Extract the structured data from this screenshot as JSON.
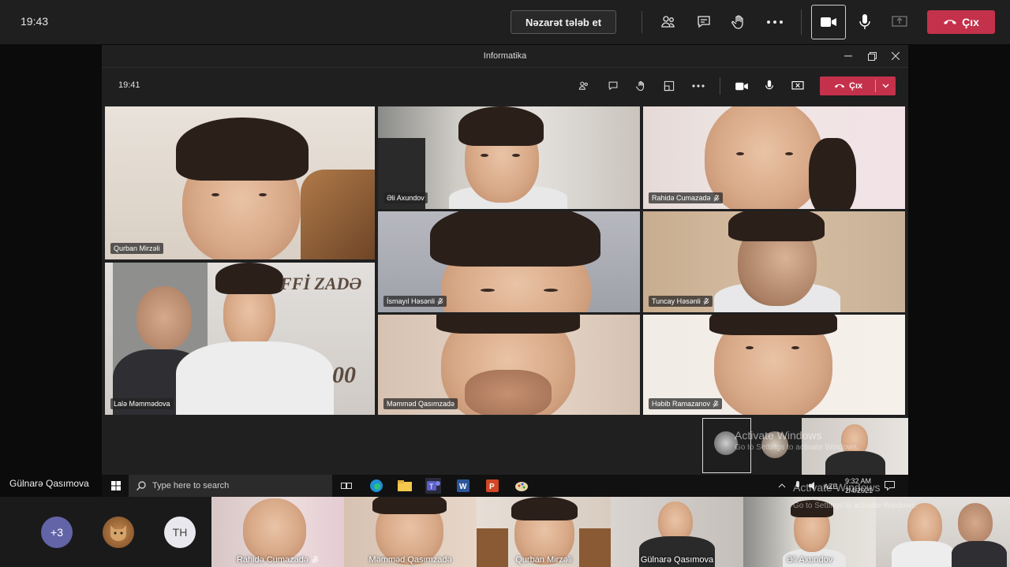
{
  "outer": {
    "time": "19:43",
    "request_control_label": "Nəzarət tələb et",
    "leave_label": "Çıx",
    "icons": [
      "people-icon",
      "chat-icon",
      "raise-hand-icon",
      "more-icon",
      "camera-icon",
      "mic-icon",
      "share-icon",
      "hang-up-icon"
    ]
  },
  "inner": {
    "window_title": "Informatika",
    "time": "19:41",
    "leave_label": "Çıx"
  },
  "participants": [
    {
      "name": "Qurban Mirzəli",
      "muted": false
    },
    {
      "name": "Əli Axundov",
      "muted": false
    },
    {
      "name": "Rahidə Cumazadə",
      "muted": true
    },
    {
      "name": "İsmayıl Həsənli",
      "muted": true
    },
    {
      "name": "Tuncay Həsənli",
      "muted": true
    },
    {
      "name": "Lalə Məmmədova",
      "muted": false
    },
    {
      "name": "Məmməd Qasımzadə",
      "muted": false
    },
    {
      "name": "Həbib Ramazanov",
      "muted": true
    }
  ],
  "watermark": {
    "title": "Activate Windows",
    "subtitle": "Go to Settings to activate Windows."
  },
  "backdrop_text": {
    "banner": "FFİ ZADƏ",
    "number": "00"
  },
  "taskbar": {
    "search_placeholder": "Type here to search",
    "lang": "AZE",
    "clock_time": "9:32 AM",
    "clock_date": "2/4/2021"
  },
  "presenter_name": "Gülnarə Qasımova",
  "strip": {
    "overflow_count": "+3",
    "avatar_initials": "TH",
    "tiles": [
      {
        "name": "Rahidə Cumazadə",
        "muted": true
      },
      {
        "name": "Məmməd Qasımzadə",
        "muted": false
      },
      {
        "name": "Qurban Mirzəli",
        "muted": false
      },
      {
        "name": "Gülnarə Qasımova",
        "muted": false
      },
      {
        "name": "Əli Axundov",
        "muted": false
      }
    ]
  },
  "colors": {
    "leave_red": "#c4314b",
    "bar_bg": "#1f1f1f"
  }
}
